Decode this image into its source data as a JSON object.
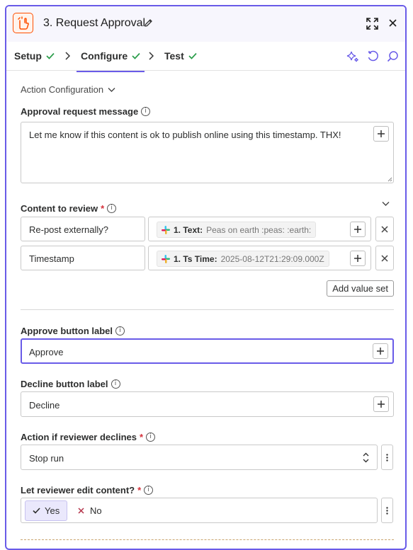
{
  "header": {
    "title": "3. Request Approval",
    "app_icon": "zapier-approval-hand-icon",
    "accent": "#695be8",
    "brand": "#ff4f00"
  },
  "tabs": [
    {
      "label": "Setup",
      "done": true
    },
    {
      "label": "Configure",
      "done": true,
      "active": true
    },
    {
      "label": "Test",
      "done": true
    }
  ],
  "toolbar_icons": [
    "sparkle-icon",
    "refresh-icon",
    "search-icon"
  ],
  "section": {
    "label": "Action Configuration"
  },
  "approval_message": {
    "label": "Approval request message",
    "value": "Let me know if this content is ok to publish online using this timestamp. THX!"
  },
  "content_review": {
    "label": "Content to review",
    "rows": [
      {
        "key": "Re-post externally?",
        "pill_name": "1. Text:",
        "pill_value": "Peas on earth :peas: :earth:"
      },
      {
        "key": "Timestamp",
        "pill_name": "1. Ts Time:",
        "pill_value": "2025-08-12T21:29:09.000Z"
      }
    ],
    "add_label": "Add value set"
  },
  "approve": {
    "label": "Approve button label",
    "value": "Approve"
  },
  "decline": {
    "label": "Decline button label",
    "value": "Decline"
  },
  "action_decline": {
    "label": "Action if reviewer declines",
    "value": "Stop run"
  },
  "edit_content": {
    "label": "Let reviewer edit content?",
    "yes": "Yes",
    "no": "No",
    "selected": "Yes"
  }
}
